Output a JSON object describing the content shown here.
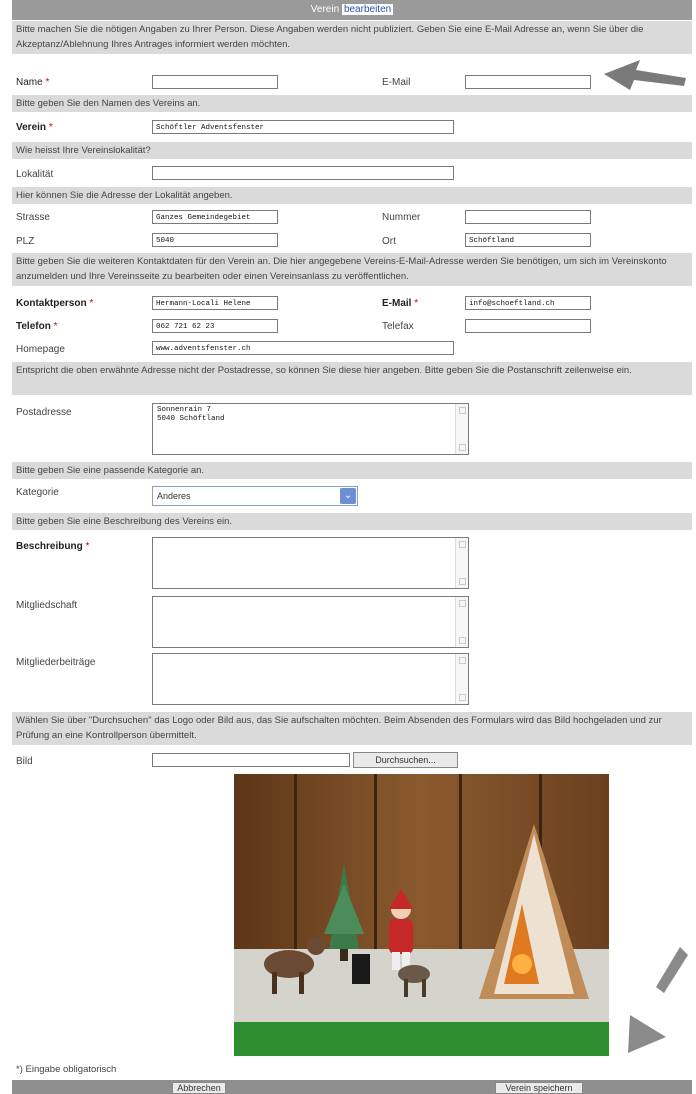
{
  "header": {
    "title_prefix": "Verein",
    "title_highlight": "bearbeiten"
  },
  "intro_text": "Bitte machen Sie die nötigen Angaben zu Ihrer Person. Diese Angaben werden nicht publiziert. Geben Sie eine E-Mail Adresse an, wenn Sie über die Akzeptanz/Ablehnung Ihres Antrages informiert werden möchten.",
  "person": {
    "name_label": "Name",
    "email_label": "E-Mail",
    "name_value": "",
    "email_value": ""
  },
  "verein_info": "Bitte geben Sie den Namen des Vereins an.",
  "verein": {
    "label": "Verein",
    "value": "Schöftler Adventsfenster"
  },
  "lokal_info": "Wie heisst Ihre Vereinslokalität?",
  "lokal": {
    "label": "Lokalität",
    "value": ""
  },
  "address_info": "Hier können Sie die Adresse der Lokalität angeben.",
  "address": {
    "strasse_label": "Strasse",
    "strasse_value": "Ganzes Gemeindegebiet",
    "nummer_label": "Nummer",
    "nummer_value": "",
    "plz_label": "PLZ",
    "plz_value": "5040",
    "ort_label": "Ort",
    "ort_value": "Schöftland"
  },
  "contact_info": "Bitte geben Sie die weiteren Kontaktdaten für den Verein an. Die hier angegebene Vereins-E-Mail-Adresse werden Sie benötigen, um sich im Vereinskonto anzumelden und Ihre Vereinsseite zu bearbeiten oder einen Vereinsanlass zu veröffentlichen.",
  "contact": {
    "person_label": "Kontaktperson",
    "person_value": "Hermann-Locali Helene",
    "email_label": "E-Mail",
    "email_value": "info@schoeftland.ch",
    "telefon_label": "Telefon",
    "telefon_value": "062 721 62 23",
    "telefax_label": "Telefax",
    "telefax_value": "",
    "homepage_label": "Homepage",
    "homepage_value": "www.adventsfenster.ch"
  },
  "post_info": "Entspricht die oben erwähnte Adresse nicht der Postadresse, so können Sie diese hier angeben. Bitte geben Sie die Postanschrift zeilenweise ein.",
  "post": {
    "label": "Postadresse",
    "value": "Sonnenrain 7\n5040 Schöftland"
  },
  "kategorie_info": "Bitte geben Sie eine passende Kategorie an.",
  "kategorie": {
    "label": "Kategorie",
    "selected": "Anderes"
  },
  "beschreibung_info": "Bitte geben Sie eine Beschreibung des Vereins ein.",
  "beschreibung": {
    "beschreibung_label": "Beschreibung",
    "mitgliedschaft_label": "Mitgliedschaft",
    "beitraege_label": "Mitgliederbeiträge"
  },
  "bild_info": "Wählen Sie über \"Durchsuchen\" das Logo oder Bild aus, das Sie aufschalten möchten. Beim Absenden des Formulars wird das Bild hochgeladen und zur Prüfung an eine Kontrollperson übermittelt.",
  "bild": {
    "label": "Bild",
    "browse_label": "Durchsuchen..."
  },
  "required_star": "*",
  "footer": {
    "note": "*) Eingabe obligatorisch",
    "cancel_label": "Abbrechen",
    "save_label": "Verein speichern"
  },
  "colors": {
    "header_bg": "#9a9a9a",
    "info_bg": "#dadada",
    "link_blue": "#2b4fa8",
    "select_arrow": "#6d8fd3"
  }
}
